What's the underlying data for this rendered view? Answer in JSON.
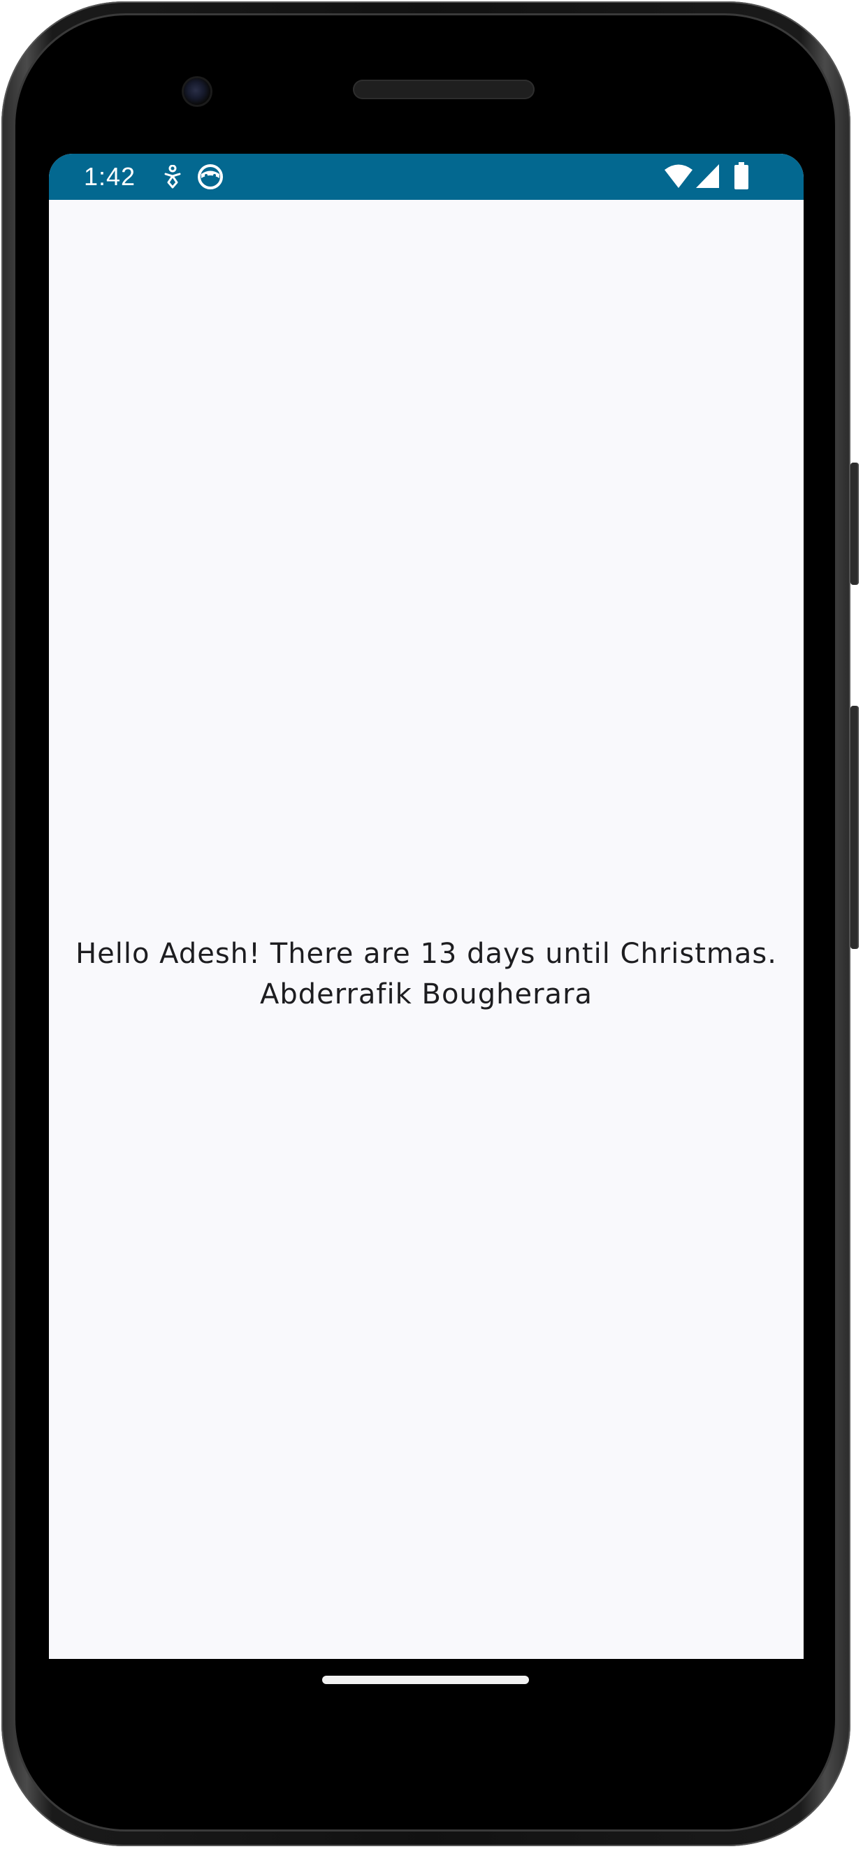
{
  "status_bar": {
    "time": "1:42",
    "background_color": "#036890",
    "left_icons": [
      "accessibility-icon",
      "assistant-face-icon"
    ],
    "right_icons": [
      "wifi-icon",
      "cellular-signal-icon",
      "battery-icon"
    ]
  },
  "main": {
    "greeting_line1": "Hello Adesh! There are 13 days until Christmas.",
    "greeting_line2": "Abderrafik Bougherara",
    "background_color": "#f9f9fc",
    "text_color": "#1d1d20"
  },
  "navigation": {
    "home_indicator": "home-gesture-pill"
  }
}
